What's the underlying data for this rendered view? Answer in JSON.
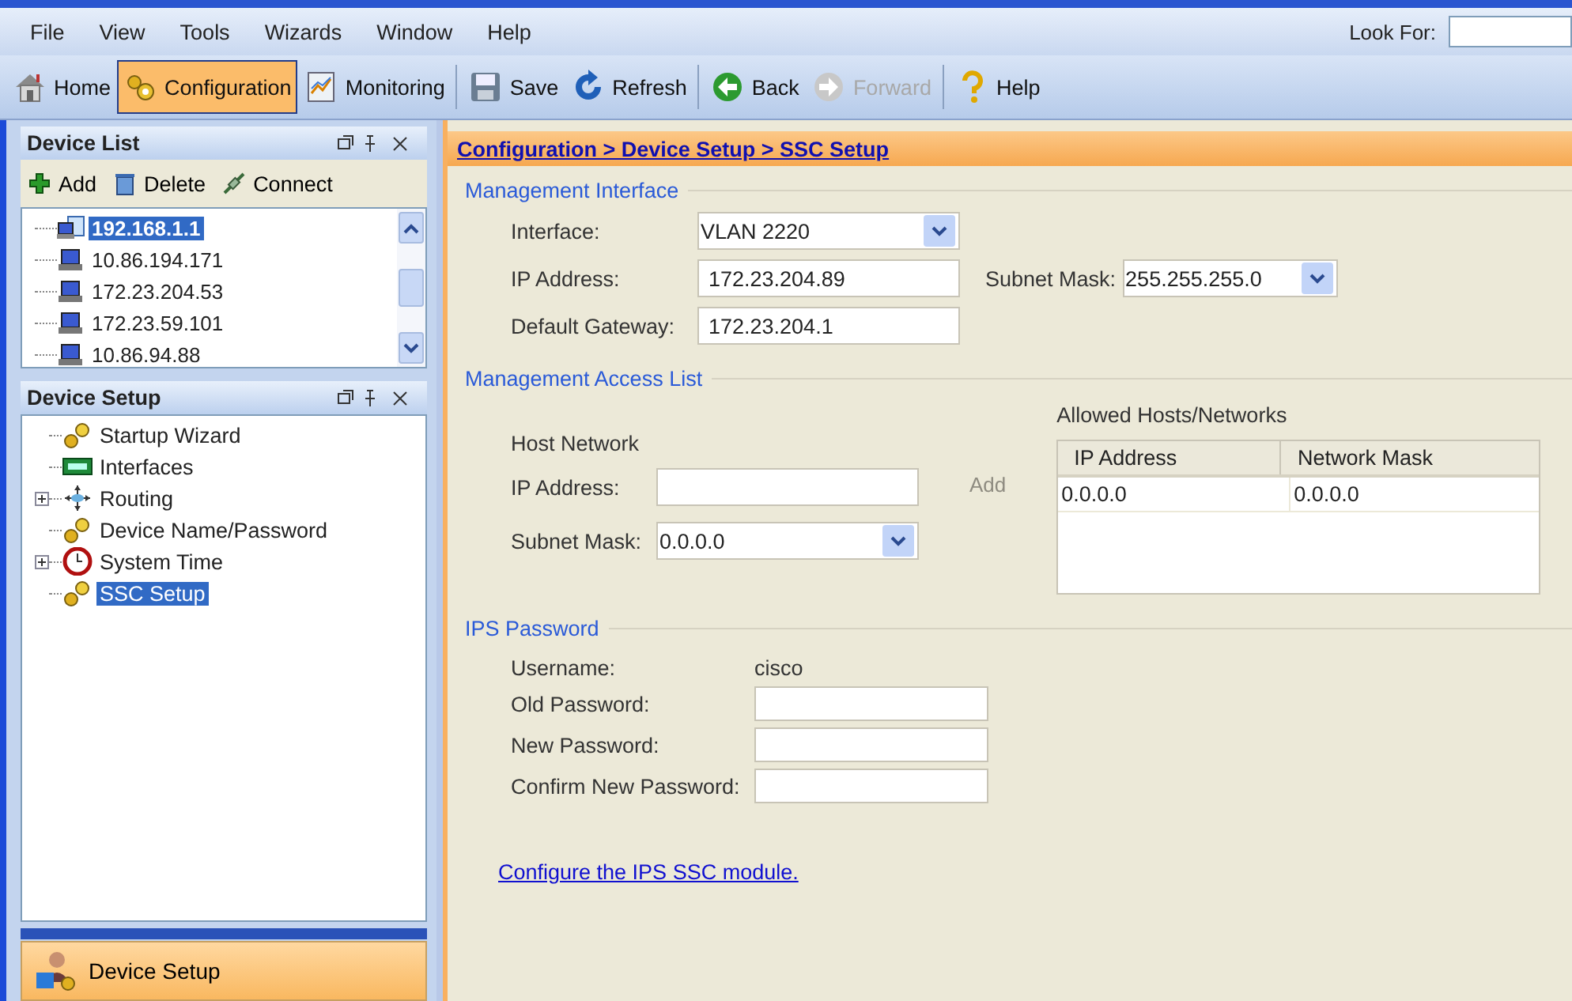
{
  "menu": [
    "File",
    "View",
    "Tools",
    "Wizards",
    "Window",
    "Help"
  ],
  "look_for": {
    "label": "Look For:"
  },
  "toolbar": [
    {
      "label": "Home",
      "kind": "home",
      "selected": false,
      "disabled": false
    },
    {
      "label": "Configuration",
      "kind": "config",
      "selected": true,
      "disabled": false
    },
    {
      "label": "Monitoring",
      "kind": "monitor",
      "selected": false,
      "disabled": false
    },
    {
      "label": "Save",
      "kind": "save",
      "selected": false,
      "disabled": false
    },
    {
      "label": "Refresh",
      "kind": "refresh",
      "selected": false,
      "disabled": false
    },
    {
      "label": "Back",
      "kind": "back",
      "selected": false,
      "disabled": false
    },
    {
      "label": "Forward",
      "kind": "forward",
      "selected": false,
      "disabled": true
    },
    {
      "label": "Help",
      "kind": "help",
      "selected": false,
      "disabled": false
    }
  ],
  "device_list": {
    "title": "Device List",
    "actions": [
      {
        "label": "Add",
        "kind": "add"
      },
      {
        "label": "Delete",
        "kind": "delete"
      },
      {
        "label": "Connect",
        "kind": "connect"
      }
    ],
    "items": [
      {
        "label": "192.168.1.1",
        "kind": "host",
        "selected": true
      },
      {
        "label": "10.86.194.171",
        "kind": "server",
        "selected": false
      },
      {
        "label": "172.23.204.53",
        "kind": "server",
        "selected": false
      },
      {
        "label": "172.23.59.101",
        "kind": "server",
        "selected": false
      },
      {
        "label": "10.86.94.88",
        "kind": "server",
        "selected": false
      }
    ]
  },
  "device_setup": {
    "title": "Device Setup",
    "items": [
      {
        "label": "Startup Wizard",
        "kind": "gears",
        "expandable": false,
        "selected": false
      },
      {
        "label": "Interfaces",
        "kind": "board",
        "expandable": false,
        "selected": false
      },
      {
        "label": "Routing",
        "kind": "arrows",
        "expandable": true,
        "selected": false
      },
      {
        "label": "Device Name/Password",
        "kind": "gears",
        "expandable": false,
        "selected": false
      },
      {
        "label": "System Time",
        "kind": "clock",
        "expandable": true,
        "selected": false
      },
      {
        "label": "SSC Setup",
        "kind": "gears",
        "expandable": false,
        "selected": true
      }
    ]
  },
  "nav_button": {
    "label": "Device Setup"
  },
  "breadcrumb": "Configuration > Device Setup > SSC Setup",
  "management_interface": {
    "title": "Management Interface",
    "interface_label": "Interface:",
    "interface": "VLAN 2220",
    "ip_label": "IP Address:",
    "ip": "172.23.204.89",
    "mask_label": "Subnet Mask:",
    "mask": "255.255.255.0",
    "gateway_label": "Default Gateway:",
    "gateway": "172.23.204.1"
  },
  "management_access_list": {
    "title": "Management Access List",
    "host_network": "Host Network",
    "ip_label": "IP Address:",
    "mask_label": "Subnet Mask:",
    "mask": "0.0.0.0",
    "add_button": {
      "label": "Add",
      "disabled": true
    },
    "table_title": "Allowed Hosts/Networks",
    "columns": [
      "IP Address",
      "Network Mask"
    ],
    "rows": [
      [
        "0.0.0.0",
        "0.0.0.0"
      ]
    ]
  },
  "ips_password": {
    "title": "IPS Password",
    "username_label": "Username:",
    "username": "cisco",
    "fields": [
      "Old Password:",
      "New Password:",
      "Confirm New Password:"
    ]
  },
  "link": "Configure the IPS SSC module."
}
